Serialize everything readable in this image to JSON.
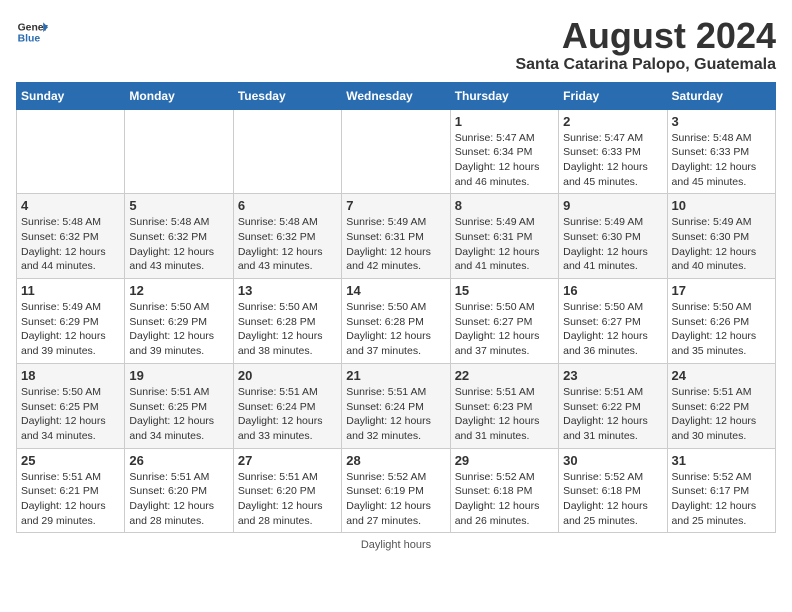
{
  "header": {
    "logo_line1": "General",
    "logo_line2": "Blue",
    "month_year": "August 2024",
    "location": "Santa Catarina Palopo, Guatemala"
  },
  "days_of_week": [
    "Sunday",
    "Monday",
    "Tuesday",
    "Wednesday",
    "Thursday",
    "Friday",
    "Saturday"
  ],
  "footer": {
    "daylight_label": "Daylight hours"
  },
  "weeks": [
    {
      "days": [
        {
          "num": "",
          "info": ""
        },
        {
          "num": "",
          "info": ""
        },
        {
          "num": "",
          "info": ""
        },
        {
          "num": "",
          "info": ""
        },
        {
          "num": "1",
          "info": "Sunrise: 5:47 AM\nSunset: 6:34 PM\nDaylight: 12 hours\nand 46 minutes."
        },
        {
          "num": "2",
          "info": "Sunrise: 5:47 AM\nSunset: 6:33 PM\nDaylight: 12 hours\nand 45 minutes."
        },
        {
          "num": "3",
          "info": "Sunrise: 5:48 AM\nSunset: 6:33 PM\nDaylight: 12 hours\nand 45 minutes."
        }
      ]
    },
    {
      "days": [
        {
          "num": "4",
          "info": "Sunrise: 5:48 AM\nSunset: 6:32 PM\nDaylight: 12 hours\nand 44 minutes."
        },
        {
          "num": "5",
          "info": "Sunrise: 5:48 AM\nSunset: 6:32 PM\nDaylight: 12 hours\nand 43 minutes."
        },
        {
          "num": "6",
          "info": "Sunrise: 5:48 AM\nSunset: 6:32 PM\nDaylight: 12 hours\nand 43 minutes."
        },
        {
          "num": "7",
          "info": "Sunrise: 5:49 AM\nSunset: 6:31 PM\nDaylight: 12 hours\nand 42 minutes."
        },
        {
          "num": "8",
          "info": "Sunrise: 5:49 AM\nSunset: 6:31 PM\nDaylight: 12 hours\nand 41 minutes."
        },
        {
          "num": "9",
          "info": "Sunrise: 5:49 AM\nSunset: 6:30 PM\nDaylight: 12 hours\nand 41 minutes."
        },
        {
          "num": "10",
          "info": "Sunrise: 5:49 AM\nSunset: 6:30 PM\nDaylight: 12 hours\nand 40 minutes."
        }
      ]
    },
    {
      "days": [
        {
          "num": "11",
          "info": "Sunrise: 5:49 AM\nSunset: 6:29 PM\nDaylight: 12 hours\nand 39 minutes."
        },
        {
          "num": "12",
          "info": "Sunrise: 5:50 AM\nSunset: 6:29 PM\nDaylight: 12 hours\nand 39 minutes."
        },
        {
          "num": "13",
          "info": "Sunrise: 5:50 AM\nSunset: 6:28 PM\nDaylight: 12 hours\nand 38 minutes."
        },
        {
          "num": "14",
          "info": "Sunrise: 5:50 AM\nSunset: 6:28 PM\nDaylight: 12 hours\nand 37 minutes."
        },
        {
          "num": "15",
          "info": "Sunrise: 5:50 AM\nSunset: 6:27 PM\nDaylight: 12 hours\nand 37 minutes."
        },
        {
          "num": "16",
          "info": "Sunrise: 5:50 AM\nSunset: 6:27 PM\nDaylight: 12 hours\nand 36 minutes."
        },
        {
          "num": "17",
          "info": "Sunrise: 5:50 AM\nSunset: 6:26 PM\nDaylight: 12 hours\nand 35 minutes."
        }
      ]
    },
    {
      "days": [
        {
          "num": "18",
          "info": "Sunrise: 5:50 AM\nSunset: 6:25 PM\nDaylight: 12 hours\nand 34 minutes."
        },
        {
          "num": "19",
          "info": "Sunrise: 5:51 AM\nSunset: 6:25 PM\nDaylight: 12 hours\nand 34 minutes."
        },
        {
          "num": "20",
          "info": "Sunrise: 5:51 AM\nSunset: 6:24 PM\nDaylight: 12 hours\nand 33 minutes."
        },
        {
          "num": "21",
          "info": "Sunrise: 5:51 AM\nSunset: 6:24 PM\nDaylight: 12 hours\nand 32 minutes."
        },
        {
          "num": "22",
          "info": "Sunrise: 5:51 AM\nSunset: 6:23 PM\nDaylight: 12 hours\nand 31 minutes."
        },
        {
          "num": "23",
          "info": "Sunrise: 5:51 AM\nSunset: 6:22 PM\nDaylight: 12 hours\nand 31 minutes."
        },
        {
          "num": "24",
          "info": "Sunrise: 5:51 AM\nSunset: 6:22 PM\nDaylight: 12 hours\nand 30 minutes."
        }
      ]
    },
    {
      "days": [
        {
          "num": "25",
          "info": "Sunrise: 5:51 AM\nSunset: 6:21 PM\nDaylight: 12 hours\nand 29 minutes."
        },
        {
          "num": "26",
          "info": "Sunrise: 5:51 AM\nSunset: 6:20 PM\nDaylight: 12 hours\nand 28 minutes."
        },
        {
          "num": "27",
          "info": "Sunrise: 5:51 AM\nSunset: 6:20 PM\nDaylight: 12 hours\nand 28 minutes."
        },
        {
          "num": "28",
          "info": "Sunrise: 5:52 AM\nSunset: 6:19 PM\nDaylight: 12 hours\nand 27 minutes."
        },
        {
          "num": "29",
          "info": "Sunrise: 5:52 AM\nSunset: 6:18 PM\nDaylight: 12 hours\nand 26 minutes."
        },
        {
          "num": "30",
          "info": "Sunrise: 5:52 AM\nSunset: 6:18 PM\nDaylight: 12 hours\nand 25 minutes."
        },
        {
          "num": "31",
          "info": "Sunrise: 5:52 AM\nSunset: 6:17 PM\nDaylight: 12 hours\nand 25 minutes."
        }
      ]
    }
  ]
}
